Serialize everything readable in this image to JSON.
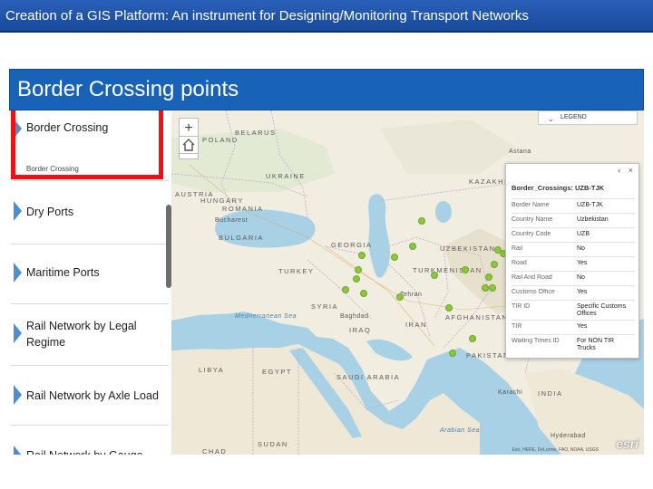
{
  "slide": {
    "title": "Creation of a GIS Platform: An instrument for Designing/Monitoring Transport Networks",
    "section_heading": "Border Crossing points"
  },
  "sidebar": {
    "items": [
      {
        "label": "Border Crossing",
        "sublabel": "Border Crossing",
        "selected": true
      },
      {
        "label": "Dry Ports"
      },
      {
        "label": "Maritime Ports"
      },
      {
        "label": "Rail Network by Legal Regime"
      },
      {
        "label": "Rail Network by Axle Load"
      },
      {
        "label": "Rail Network by Gauge"
      }
    ]
  },
  "map": {
    "zoom_in": "+",
    "zoom_out": "−",
    "legend_label": "LEGEND",
    "attribution": "Esri, HERE, DeLorme, FAO, NOAA, USGS",
    "logo": "esri",
    "labels": [
      {
        "text": "BELARUS",
        "kind": "country"
      },
      {
        "text": "POLAND",
        "kind": "country"
      },
      {
        "text": "UKRAINE",
        "kind": "country"
      },
      {
        "text": "AUSTRIA",
        "kind": "country"
      },
      {
        "text": "HUNGARY",
        "kind": "country"
      },
      {
        "text": "ROMANIA",
        "kind": "country"
      },
      {
        "text": "BULGARIA",
        "kind": "country"
      },
      {
        "text": "TURKEY",
        "kind": "country"
      },
      {
        "text": "GEORGIA",
        "kind": "country"
      },
      {
        "text": "SYRIA",
        "kind": "country"
      },
      {
        "text": "IRAQ",
        "kind": "country"
      },
      {
        "text": "IRAN",
        "kind": "country"
      },
      {
        "text": "TURKMENISTAN",
        "kind": "country"
      },
      {
        "text": "UZBEKISTAN",
        "kind": "country"
      },
      {
        "text": "KAZAKHSTAN",
        "kind": "country"
      },
      {
        "text": "AFGHANISTAN",
        "kind": "country"
      },
      {
        "text": "PAKISTAN",
        "kind": "country"
      },
      {
        "text": "INDIA",
        "kind": "country"
      },
      {
        "text": "SAUDI ARABIA",
        "kind": "country"
      },
      {
        "text": "EGYPT",
        "kind": "country"
      },
      {
        "text": "LIBYA",
        "kind": "country"
      },
      {
        "text": "SUDAN",
        "kind": "country"
      },
      {
        "text": "CHAD",
        "kind": "country"
      },
      {
        "text": "Mediterranean Sea",
        "kind": "sea"
      },
      {
        "text": "Arabian Sea",
        "kind": "sea"
      },
      {
        "text": "Bucharest",
        "kind": "city"
      },
      {
        "text": "Baghdad",
        "kind": "city"
      },
      {
        "text": "Karachi",
        "kind": "city"
      },
      {
        "text": "Hyderabad",
        "kind": "city"
      },
      {
        "text": "Astana",
        "kind": "city"
      },
      {
        "text": "Tehran",
        "kind": "city"
      }
    ]
  },
  "popup": {
    "title": "Border_Crossings: UZB-TJK",
    "rows": [
      {
        "key": "Border Name",
        "value": "UZB-TJK"
      },
      {
        "key": "Country Name",
        "value": "Uzbekistan"
      },
      {
        "key": "Country Code",
        "value": "UZB"
      },
      {
        "key": "Rail",
        "value": "No"
      },
      {
        "key": "Road",
        "value": "Yes"
      },
      {
        "key": "Rail And Road",
        "value": "No"
      },
      {
        "key": "Customs Office",
        "value": "Yes"
      },
      {
        "key": "TIR ID",
        "value": "Specific Customs Offices"
      },
      {
        "key": "TIR",
        "value": "Yes"
      },
      {
        "key": "Waiting Times ID",
        "value": "For NON TIR Trucks"
      }
    ]
  },
  "colors": {
    "title_bar": "#184a9c",
    "banner": "#1863b8",
    "selection": "#ee1111",
    "arrow": "#4a8fd6",
    "point": "#8cc63f",
    "water": "#a9d1e6",
    "land": "#f1ede1"
  }
}
